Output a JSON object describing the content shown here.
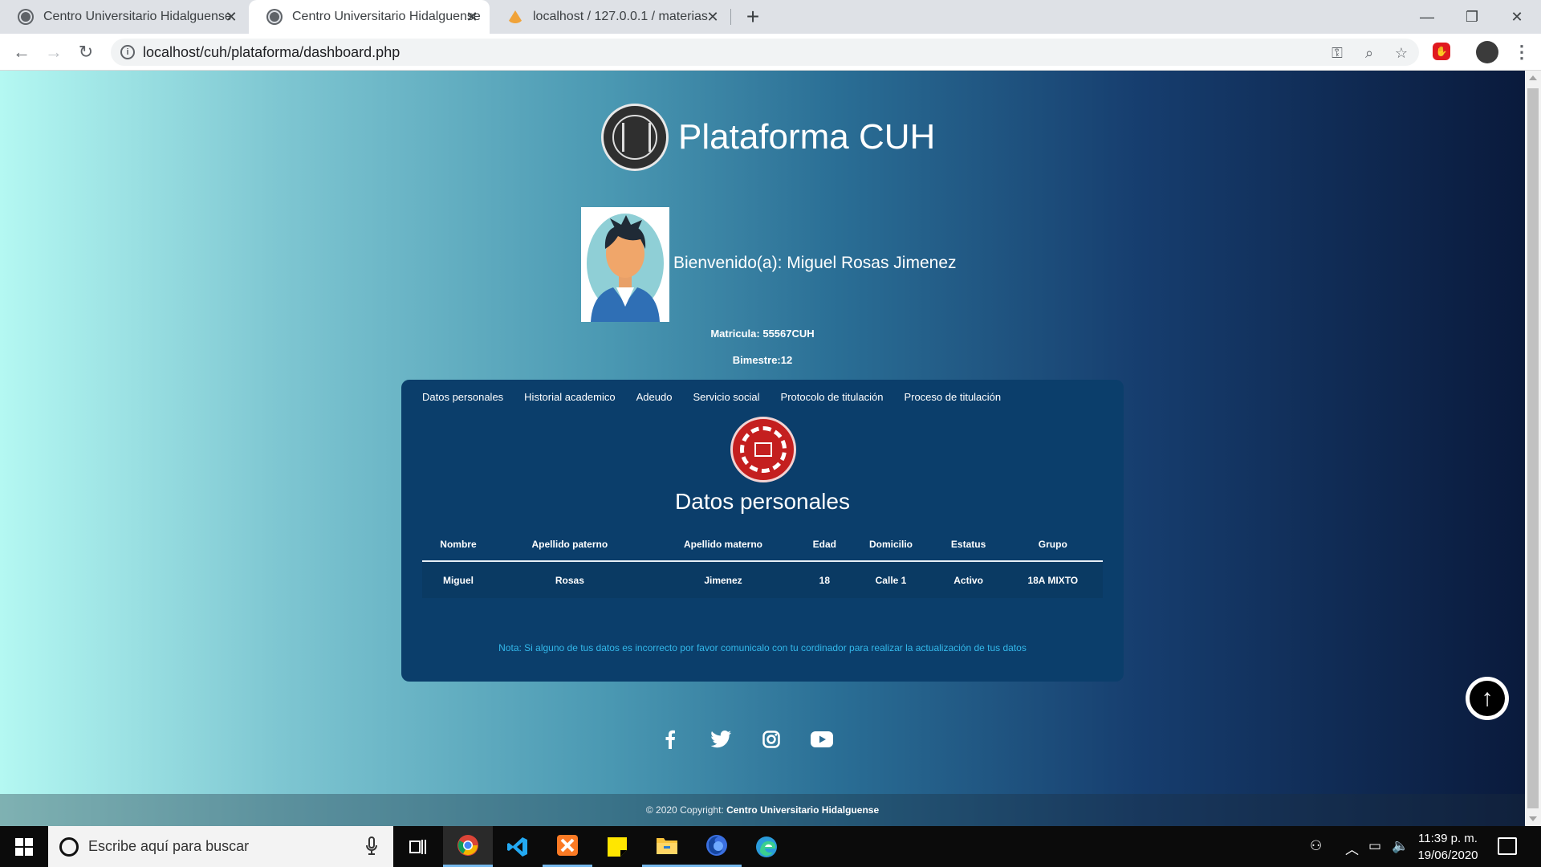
{
  "browser": {
    "tabs": [
      {
        "title": "Centro Universitario Hidalguense"
      },
      {
        "title": "Centro Universitario Hidalguense"
      },
      {
        "title": "localhost / 127.0.0.1 / materias / "
      }
    ],
    "new_tab": "+",
    "url": "localhost/cuh/plataforma/dashboard.php"
  },
  "page": {
    "brand_title": "Plataforma CUH",
    "welcome": "Bienvenido(a): Miguel Rosas Jimenez",
    "matricula": "Matricula: 55567CUH",
    "bimestre": "Bimestre:12",
    "menu": [
      "Datos personales",
      "Historial academico",
      "Adeudo",
      "Servicio social",
      "Protocolo de titulación",
      "Proceso de titulación"
    ],
    "section_title": "Datos personales",
    "table": {
      "headers": [
        "Nombre",
        "Apellido paterno",
        "Apellido materno",
        "Edad",
        "Domicilio",
        "Estatus",
        "Grupo"
      ],
      "rows": [
        [
          "Miguel",
          "Rosas",
          "Jimenez",
          "18",
          "Calle 1",
          "Activo",
          "18A MIXTO"
        ]
      ]
    },
    "note": "Nota: Si alguno de tus datos es incorrecto por favor comunicalo con tu cordinador para realizar la actualización de tus datos",
    "social_icons": [
      "facebook-icon",
      "twitter-icon",
      "instagram-icon",
      "youtube-icon"
    ],
    "footer_prefix": "© 2020 Copyright: ",
    "footer_link": "Centro Universitario Hidalguense"
  },
  "taskbar": {
    "search_placeholder": "Escribe aquí para buscar",
    "time": "11:39 p. m.",
    "date": "19/06/2020"
  },
  "colors": {
    "card_bg": "#0b3e6b",
    "note_color": "#33b8ea",
    "gradient_start": "#b4f8f2",
    "gradient_end": "#0a1a3c"
  }
}
